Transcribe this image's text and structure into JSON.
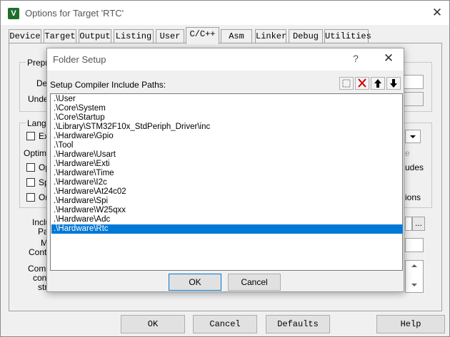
{
  "window": {
    "title": "Options for Target 'RTC'",
    "app_icon_letter": "V",
    "close_glyph": "✕"
  },
  "tabs": [
    "Device",
    "Target",
    "Output",
    "Listing",
    "User",
    "C/C++",
    "Asm",
    "Linker",
    "Debug",
    "Utilities"
  ],
  "active_tab": "C/C++",
  "background_fragments": {
    "preprocessor": "Prepro",
    "define": "Def",
    "undefine": "Undel",
    "language": "Langu",
    "ex": "Ex",
    "optimize": "Optimiz",
    "op": "Op",
    "sp": "Sp",
    "on": "On",
    "include": "Inclu",
    "paths": "Pat",
    "misc": "M",
    "controls": "Contr",
    "compiler": "Comp",
    "control": "cont",
    "string": "stri",
    "e_suffix": "e",
    "udes": "udes",
    "ions": "ions",
    "browse": "..."
  },
  "bottom_buttons": {
    "ok": "OK",
    "cancel": "Cancel",
    "defaults": "Defaults",
    "help": "Help"
  },
  "dialog": {
    "title": "Folder Setup",
    "help_glyph": "?",
    "close_glyph": "✕",
    "label": "Setup Compiler Include Paths:",
    "toolbar": {
      "new_icon": "new-folder-icon",
      "delete_icon": "delete-icon",
      "move_up_icon": "arrow-up-icon",
      "move_down_icon": "arrow-down-icon"
    },
    "paths": [
      ".\\User",
      ".\\Core\\System",
      ".\\Core\\Startup",
      ".\\Library\\STM32F10x_StdPeriph_Driver\\inc",
      ".\\Hardware\\Gpio",
      ".\\Tool",
      ".\\Hardware\\Usart",
      ".\\Hardware\\Exti",
      ".\\Hardware\\Time",
      ".\\Hardware\\I2c",
      ".\\Hardware\\At24c02",
      ".\\Hardware\\Spi",
      ".\\Hardware\\W25qxx",
      ".\\Hardware\\Adc",
      ".\\Hardware\\Rtc"
    ],
    "selected_index": 14,
    "ok_label": "OK",
    "cancel_label": "Cancel"
  },
  "colors": {
    "selection": "#0078d7",
    "delete_red": "#d00000"
  }
}
